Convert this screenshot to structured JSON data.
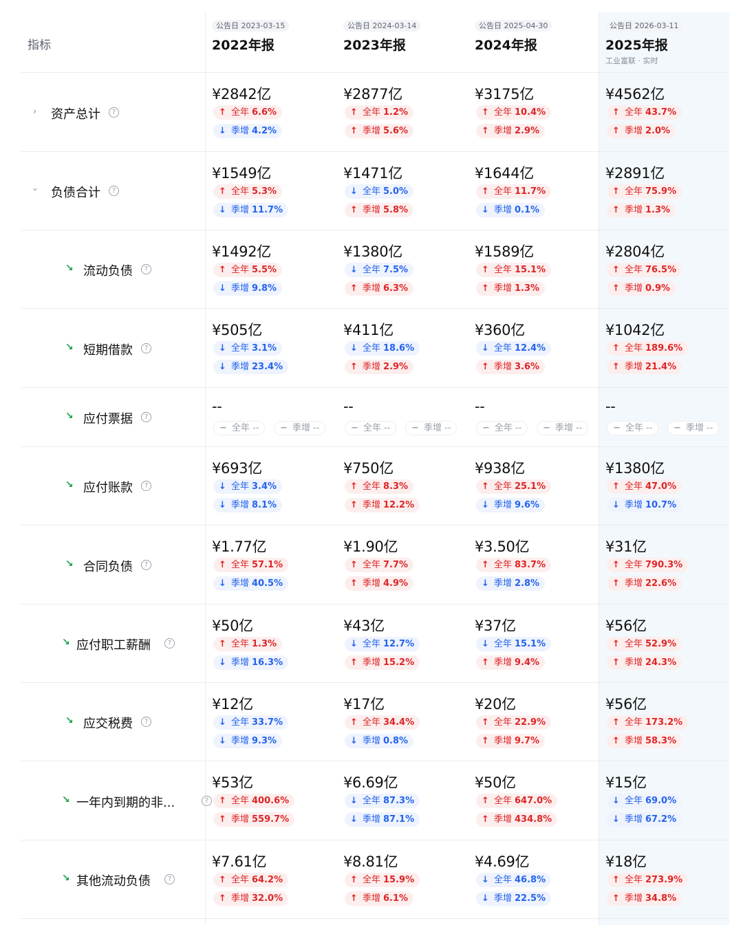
{
  "header": {
    "indicator_label": "指标",
    "periods": [
      {
        "date": "公告日 2023-03-15",
        "year": "2022年报",
        "source": ""
      },
      {
        "date": "公告日 2024-03-14",
        "year": "2023年报",
        "source": ""
      },
      {
        "date": "公告日 2025-04-30",
        "year": "2024年报",
        "source": ""
      },
      {
        "date": "公告日 2026-03-11",
        "year": "2025年报",
        "source": "工业富联 · 实时"
      }
    ]
  },
  "rows": [
    {
      "name": "资产总计",
      "expander": "collapsed",
      "cells": [
        {
          "value": "¥2842亿",
          "annual": {
            "dir": "up",
            "label": "全年",
            "pct": "6.6%"
          },
          "qoq": {
            "dir": "down",
            "label": "季增",
            "pct": "4.2%"
          }
        },
        {
          "value": "¥2877亿",
          "annual": {
            "dir": "up",
            "label": "全年",
            "pct": "1.2%"
          },
          "qoq": {
            "dir": "up",
            "label": "季增",
            "pct": "5.6%"
          }
        },
        {
          "value": "¥3175亿",
          "annual": {
            "dir": "up",
            "label": "全年",
            "pct": "10.4%"
          },
          "qoq": {
            "dir": "up",
            "label": "季增",
            "pct": "2.9%"
          }
        },
        {
          "value": "¥4562亿",
          "annual": {
            "dir": "up",
            "label": "全年",
            "pct": "43.7%"
          },
          "qoq": {
            "dir": "up",
            "label": "季增",
            "pct": "2.0%"
          }
        }
      ]
    },
    {
      "name": "负债合计",
      "expander": "expanded",
      "cells": [
        {
          "value": "¥1549亿",
          "annual": {
            "dir": "up",
            "label": "全年",
            "pct": "5.3%"
          },
          "qoq": {
            "dir": "down",
            "label": "季增",
            "pct": "11.7%"
          }
        },
        {
          "value": "¥1471亿",
          "annual": {
            "dir": "down",
            "label": "全年",
            "pct": "5.0%"
          },
          "qoq": {
            "dir": "up",
            "label": "季增",
            "pct": "5.8%"
          }
        },
        {
          "value": "¥1644亿",
          "annual": {
            "dir": "up",
            "label": "全年",
            "pct": "11.7%"
          },
          "qoq": {
            "dir": "down",
            "label": "季增",
            "pct": "0.1%"
          }
        },
        {
          "value": "¥2891亿",
          "annual": {
            "dir": "up",
            "label": "全年",
            "pct": "75.9%"
          },
          "qoq": {
            "dir": "up",
            "label": "季增",
            "pct": "1.3%"
          }
        }
      ]
    },
    {
      "name": "流动负债",
      "expander": "child",
      "cells": [
        {
          "value": "¥1492亿",
          "annual": {
            "dir": "up",
            "label": "全年",
            "pct": "5.5%"
          },
          "qoq": {
            "dir": "down",
            "label": "季增",
            "pct": "9.8%"
          }
        },
        {
          "value": "¥1380亿",
          "annual": {
            "dir": "down",
            "label": "全年",
            "pct": "7.5%"
          },
          "qoq": {
            "dir": "up",
            "label": "季增",
            "pct": "6.3%"
          }
        },
        {
          "value": "¥1589亿",
          "annual": {
            "dir": "up",
            "label": "全年",
            "pct": "15.1%"
          },
          "qoq": {
            "dir": "up",
            "label": "季增",
            "pct": "1.3%"
          }
        },
        {
          "value": "¥2804亿",
          "annual": {
            "dir": "up",
            "label": "全年",
            "pct": "76.5%"
          },
          "qoq": {
            "dir": "up",
            "label": "季增",
            "pct": "0.9%"
          }
        }
      ]
    },
    {
      "name": "短期借款",
      "expander": "child",
      "cells": [
        {
          "value": "¥505亿",
          "annual": {
            "dir": "down",
            "label": "全年",
            "pct": "3.1%"
          },
          "qoq": {
            "dir": "down",
            "label": "季增",
            "pct": "23.4%"
          }
        },
        {
          "value": "¥411亿",
          "annual": {
            "dir": "down",
            "label": "全年",
            "pct": "18.6%"
          },
          "qoq": {
            "dir": "up",
            "label": "季增",
            "pct": "2.9%"
          }
        },
        {
          "value": "¥360亿",
          "annual": {
            "dir": "down",
            "label": "全年",
            "pct": "12.4%"
          },
          "qoq": {
            "dir": "up",
            "label": "季增",
            "pct": "3.6%"
          }
        },
        {
          "value": "¥1042亿",
          "annual": {
            "dir": "up",
            "label": "全年",
            "pct": "189.6%"
          },
          "qoq": {
            "dir": "up",
            "label": "季增",
            "pct": "21.4%"
          }
        }
      ]
    },
    {
      "name": "应付票据",
      "expander": "child",
      "empty": true,
      "cells": [
        {
          "value": "--",
          "annual": {
            "dir": "none",
            "label": "全年",
            "pct": "--"
          },
          "qoq": {
            "dir": "none",
            "label": "季增",
            "pct": "--"
          }
        },
        {
          "value": "--",
          "annual": {
            "dir": "none",
            "label": "全年",
            "pct": "--"
          },
          "qoq": {
            "dir": "none",
            "label": "季增",
            "pct": "--"
          }
        },
        {
          "value": "--",
          "annual": {
            "dir": "none",
            "label": "全年",
            "pct": "--"
          },
          "qoq": {
            "dir": "none",
            "label": "季增",
            "pct": "--"
          }
        },
        {
          "value": "--",
          "annual": {
            "dir": "none",
            "label": "全年",
            "pct": "--"
          },
          "qoq": {
            "dir": "none",
            "label": "季增",
            "pct": "--"
          }
        }
      ]
    },
    {
      "name": "应付账款",
      "expander": "child",
      "cells": [
        {
          "value": "¥693亿",
          "annual": {
            "dir": "down",
            "label": "全年",
            "pct": "3.4%"
          },
          "qoq": {
            "dir": "down",
            "label": "季增",
            "pct": "8.1%"
          }
        },
        {
          "value": "¥750亿",
          "annual": {
            "dir": "up",
            "label": "全年",
            "pct": "8.3%"
          },
          "qoq": {
            "dir": "up",
            "label": "季增",
            "pct": "12.2%"
          }
        },
        {
          "value": "¥938亿",
          "annual": {
            "dir": "up",
            "label": "全年",
            "pct": "25.1%"
          },
          "qoq": {
            "dir": "down",
            "label": "季增",
            "pct": "9.6%"
          }
        },
        {
          "value": "¥1380亿",
          "annual": {
            "dir": "up",
            "label": "全年",
            "pct": "47.0%"
          },
          "qoq": {
            "dir": "down",
            "label": "季增",
            "pct": "10.7%"
          }
        }
      ]
    },
    {
      "name": "合同负债",
      "expander": "child",
      "cells": [
        {
          "value": "¥1.77亿",
          "annual": {
            "dir": "up",
            "label": "全年",
            "pct": "57.1%"
          },
          "qoq": {
            "dir": "down",
            "label": "季增",
            "pct": "40.5%"
          }
        },
        {
          "value": "¥1.90亿",
          "annual": {
            "dir": "up",
            "label": "全年",
            "pct": "7.7%"
          },
          "qoq": {
            "dir": "up",
            "label": "季增",
            "pct": "4.9%"
          }
        },
        {
          "value": "¥3.50亿",
          "annual": {
            "dir": "up",
            "label": "全年",
            "pct": "83.7%"
          },
          "qoq": {
            "dir": "down",
            "label": "季增",
            "pct": "2.8%"
          }
        },
        {
          "value": "¥31亿",
          "annual": {
            "dir": "up",
            "label": "全年",
            "pct": "790.3%"
          },
          "qoq": {
            "dir": "up",
            "label": "季增",
            "pct": "22.6%"
          }
        }
      ]
    },
    {
      "name": "应付职工薪酬",
      "expander": "child",
      "cells": [
        {
          "value": "¥50亿",
          "annual": {
            "dir": "up",
            "label": "全年",
            "pct": "1.3%"
          },
          "qoq": {
            "dir": "down",
            "label": "季增",
            "pct": "16.3%"
          }
        },
        {
          "value": "¥43亿",
          "annual": {
            "dir": "down",
            "label": "全年",
            "pct": "12.7%"
          },
          "qoq": {
            "dir": "up",
            "label": "季增",
            "pct": "15.2%"
          }
        },
        {
          "value": "¥37亿",
          "annual": {
            "dir": "down",
            "label": "全年",
            "pct": "15.1%"
          },
          "qoq": {
            "dir": "up",
            "label": "季增",
            "pct": "9.4%"
          }
        },
        {
          "value": "¥56亿",
          "annual": {
            "dir": "up",
            "label": "全年",
            "pct": "52.9%"
          },
          "qoq": {
            "dir": "up",
            "label": "季增",
            "pct": "24.3%"
          }
        }
      ]
    },
    {
      "name": "应交税费",
      "expander": "child",
      "cells": [
        {
          "value": "¥12亿",
          "annual": {
            "dir": "down",
            "label": "全年",
            "pct": "33.7%"
          },
          "qoq": {
            "dir": "down",
            "label": "季增",
            "pct": "9.3%"
          }
        },
        {
          "value": "¥17亿",
          "annual": {
            "dir": "up",
            "label": "全年",
            "pct": "34.4%"
          },
          "qoq": {
            "dir": "down",
            "label": "季增",
            "pct": "0.8%"
          }
        },
        {
          "value": "¥20亿",
          "annual": {
            "dir": "up",
            "label": "全年",
            "pct": "22.9%"
          },
          "qoq": {
            "dir": "up",
            "label": "季增",
            "pct": "9.7%"
          }
        },
        {
          "value": "¥56亿",
          "annual": {
            "dir": "up",
            "label": "全年",
            "pct": "173.2%"
          },
          "qoq": {
            "dir": "up",
            "label": "季增",
            "pct": "58.3%"
          }
        }
      ]
    },
    {
      "name": "一年内到期的非...",
      "expander": "child",
      "cells": [
        {
          "value": "¥53亿",
          "annual": {
            "dir": "up",
            "label": "全年",
            "pct": "400.6%"
          },
          "qoq": {
            "dir": "up",
            "label": "季增",
            "pct": "559.7%"
          }
        },
        {
          "value": "¥6.69亿",
          "annual": {
            "dir": "down",
            "label": "全年",
            "pct": "87.3%"
          },
          "qoq": {
            "dir": "down",
            "label": "季增",
            "pct": "87.1%"
          }
        },
        {
          "value": "¥50亿",
          "annual": {
            "dir": "up",
            "label": "全年",
            "pct": "647.0%"
          },
          "qoq": {
            "dir": "up",
            "label": "季增",
            "pct": "434.8%"
          }
        },
        {
          "value": "¥15亿",
          "annual": {
            "dir": "down",
            "label": "全年",
            "pct": "69.0%"
          },
          "qoq": {
            "dir": "down",
            "label": "季增",
            "pct": "67.2%"
          }
        }
      ]
    },
    {
      "name": "其他流动负债",
      "expander": "child",
      "cells": [
        {
          "value": "¥7.61亿",
          "annual": {
            "dir": "up",
            "label": "全年",
            "pct": "64.2%"
          },
          "qoq": {
            "dir": "up",
            "label": "季增",
            "pct": "32.0%"
          }
        },
        {
          "value": "¥8.81亿",
          "annual": {
            "dir": "up",
            "label": "全年",
            "pct": "15.9%"
          },
          "qoq": {
            "dir": "up",
            "label": "季增",
            "pct": "6.1%"
          }
        },
        {
          "value": "¥4.69亿",
          "annual": {
            "dir": "down",
            "label": "全年",
            "pct": "46.8%"
          },
          "qoq": {
            "dir": "down",
            "label": "季增",
            "pct": "22.5%"
          }
        },
        {
          "value": "¥18亿",
          "annual": {
            "dir": "up",
            "label": "全年",
            "pct": "273.9%"
          },
          "qoq": {
            "dir": "up",
            "label": "季增",
            "pct": "34.8%"
          }
        }
      ]
    }
  ],
  "icons": {
    "up": "arrow-up-icon",
    "down": "arrow-down-icon",
    "none": "dash-icon",
    "help": "question-circle-icon",
    "trend": "trend-down-icon",
    "chevron_right": "chevron-right-icon",
    "chevron_down": "chevron-down-icon"
  },
  "colors": {
    "up": "#dc2626",
    "down": "#2563eb",
    "trend": "#16a34a",
    "highlight_column": "#f3f8fd"
  }
}
